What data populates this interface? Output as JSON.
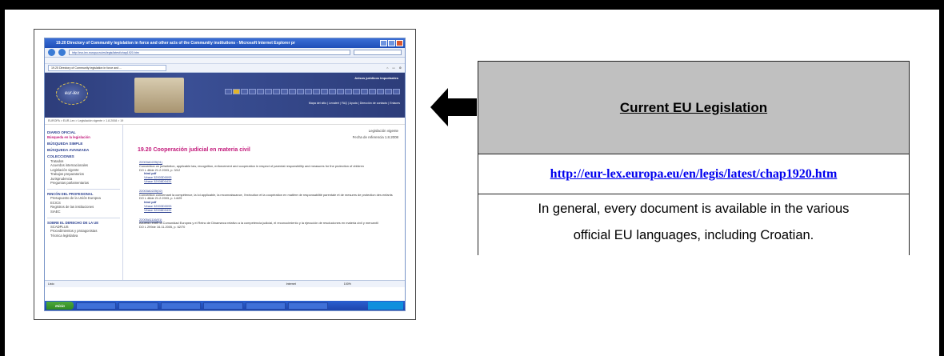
{
  "screenshot": {
    "window_title": "19.20 Directory of Community legislation in force and other acts of the Community institutions - Microsoft Internet Explorer pr",
    "address": "http://eur-lex.europa.eu/es/legis/latest/chap1920.htm",
    "tab_label": "19.20 Directory of Community legislation in force and ...",
    "header_right_title": "Avisos jurídicos importantes",
    "header_links": "Mapa del sitio | Lexalert | FAQ | Ayuda | Dirección de contacto | Enlaces",
    "breadcrumb": "EUROPA > EUR-Lex > Legislación vigente > 1.8.2008 > 19",
    "nav": {
      "diario": "DIARIO OFICIAL",
      "busqueda_legislacion": "Búsqueda en la legislación",
      "busqueda_simple": "BÚSQUEDA SIMPLE",
      "busqueda_avanzada": "BÚSQUEDA AVANZADA",
      "colecciones": "COLECCIONES",
      "collection_items": [
        "Tratados",
        "Acuerdos internacionales",
        "Legislación vigente",
        "Trabajos preparatorios",
        "Jurisprudencia",
        "Preguntas parlamentarias"
      ],
      "rincon": "RINCÓN DEL PROFESIONAL",
      "rincon_items": [
        "Presupuesto de la Unión Europea",
        "ECICS",
        "Registros de las instituciones",
        "SIAEC"
      ],
      "sobre": "SOBRE EL DERECHO DE LA UE",
      "sobre_items": [
        "SCADPLUS",
        "Procedimientos y protagonistas",
        "Técnica legislativa"
      ]
    },
    "meta_1": "Legislación vigente",
    "meta_2": "Fecha de referencia 1.8.2008",
    "section_heading": "19.20 Cooperación judicial en materia civil",
    "entries": [
      {
        "code": "22003A0225(01)",
        "text": "Convention on jurisdiction, applicable law, recognition, enforcement and cooperation in respect of parental responsibility and measures for the protection of children",
        "ref": "DO L 48de 21.2.2003, p. 3/12",
        "links": "html  pdf",
        "sub1": "Véase 32003D0093",
        "sub2": "Véase 32008D0431"
      },
      {
        "code": "22003A0225(02)",
        "text": "Convention concernant la compétence, la loi applicable, la reconnaissance, l'exécution et la coopération en matière de responsabilité parentale et de mesures de protection des enfants",
        "ref": "DO L 48de 21.2.2003, p. 14/29",
        "links": "html  pdf",
        "sub1": "Véase 32003D0093",
        "sub2": "Véase 32008D0431"
      },
      {
        "code": "22005A1116(01)",
        "text": "Acuerdo entre la Comunidad Europea y el Reino de Dinamarca relativo a la competencia judicial, el reconocimiento y la ejecución de resoluciones en materia civil y mercantil",
        "ref": "DO L 299de 16.11.2005, p. 62/70",
        "links": "",
        "sub1": "",
        "sub2": ""
      }
    ],
    "status_left": "Listo",
    "status_mid": "Internet",
    "status_zoom": "100%",
    "start_label": "Inicio"
  },
  "info_box": {
    "title": "Current EU Legislation",
    "link": "http://eur-lex.europa.eu/en/legis/latest/chap1920.htm",
    "description_line1": "In general, every document is available in the various",
    "description_line2": "official EU languages, including Croatian."
  },
  "arrow": {
    "direction": "left",
    "color": "#000000"
  }
}
